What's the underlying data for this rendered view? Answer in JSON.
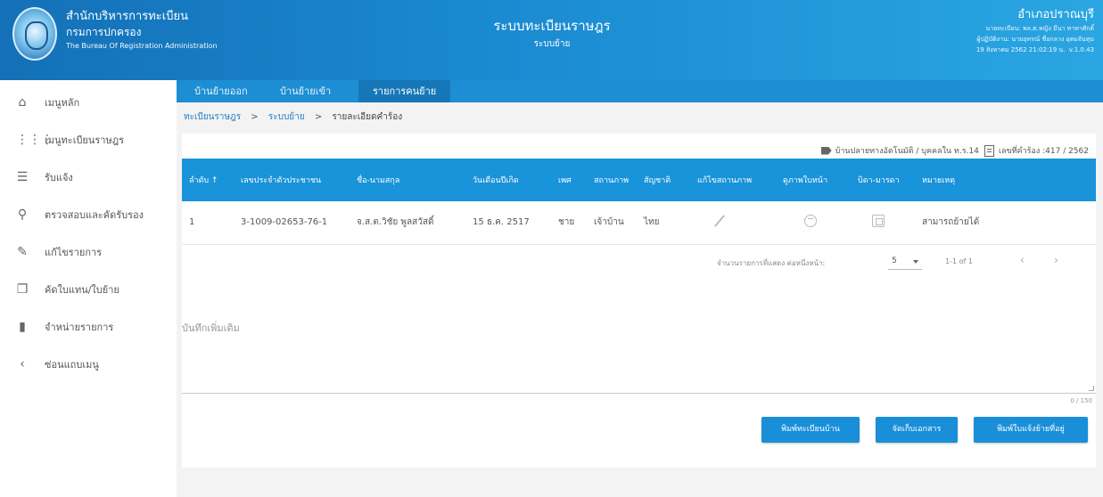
{
  "header": {
    "org_line1": "สำนักบริหารการทะเบียน",
    "org_line2": "กรมการปกครอง",
    "org_line3": "The Bureau Of Registration Administration",
    "system_title": "ระบบทะเบียนราษฎร",
    "system_subtitle": "ระบบย้าย",
    "district": "อำเภอปราณบุรี",
    "user_line1": "นายทะเบียน: พล.ต.หญิง มีนา ทาทาศักดิ์",
    "user_line2": "ผู้ปฏิบัติงาน: นายอุทรณ์ ชื่อกลาง อุดมจันทุม",
    "datetime": "19 สิงหาคม 2562 21:02:19 น.",
    "version": "v.1.0.43"
  },
  "sidebar": {
    "items": [
      {
        "label": "เมนูหลัก",
        "icon": "home-icon"
      },
      {
        "label": "เมนูทะเบียนราษฎร",
        "icon": "grid-icon"
      },
      {
        "label": "รับแจ้ง",
        "icon": "list-icon"
      },
      {
        "label": "ตรวจสอบและคัดรับรอง",
        "icon": "search-icon"
      },
      {
        "label": "แก้ไขรายการ",
        "icon": "edit-icon"
      },
      {
        "label": "คัดใบแทน/ใบย้าย",
        "icon": "copy-icon"
      },
      {
        "label": "จำหน่ายรายการ",
        "icon": "trash-icon"
      },
      {
        "label": "ซ่อนแถบเมนู",
        "icon": "chevron-left-icon"
      }
    ]
  },
  "tabs": [
    {
      "label": "บ้านย้ายออก"
    },
    {
      "label": "บ้านย้ายเข้า"
    },
    {
      "label": "รายการคนย้าย"
    }
  ],
  "breadcrumb": {
    "item1": "ทะเบียนราษฎร",
    "item2": "ระบบย้าย",
    "current": "รายละเอียดคำร้อง",
    "sep": ">"
  },
  "info": {
    "place": "บ้านปลายทางอัตโนมัติ / บุคคลใน ท.ร.14",
    "request_no": "เลขที่คำร้อง :417 / 2562"
  },
  "table": {
    "headers": [
      "ลำดับ ↑",
      "เลขประจำตัวประชาชน",
      "ชื่อ-นามสกุล",
      "วันเดือนปีเกิด",
      "เพศ",
      "สถานภาพ",
      "สัญชาติ",
      "แก้ไขสถานภาพ",
      "ดูภาพใบหน้า",
      "บิดา-มารดา",
      "หมายเหตุ"
    ],
    "rows": [
      {
        "no": "1",
        "pid": "3-1009-02653-76-1",
        "name": "จ.ส.ต.วิชัย พูลสวัสดิ์",
        "dob": "15 ธ.ค. 2517",
        "sex": "ชาย",
        "status": "เจ้าบ้าน",
        "nationality": "ไทย",
        "note": "สามารถย้ายได้"
      }
    ]
  },
  "pager": {
    "rows_label": "จำนวนรายการที่แสดง ต่อหนึ่งหน้า:",
    "page_size": "5",
    "range": "1-1 of 1",
    "prev": "‹",
    "next": "›"
  },
  "notes": {
    "placeholder": "บันทึกเพิ่มเติม",
    "counter": "0 / 150"
  },
  "buttons": {
    "print_house": "พิมพ์ทะเบียนบ้าน",
    "store_docs": "จัดเก็บเอกสาร",
    "print_notice": "พิมพ์ใบแจ้งย้ายที่อยู่"
  }
}
